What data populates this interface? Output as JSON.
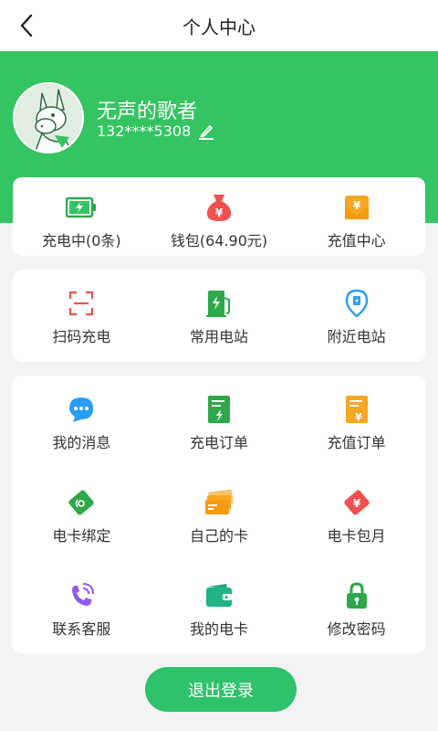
{
  "header": {
    "title": "个人中心",
    "back_icon": "chevron-left-icon"
  },
  "profile": {
    "name": "无声的歌者",
    "phone": "132****5308",
    "edit_icon": "pencil-icon",
    "avatar_icon": "donkey-avatar"
  },
  "colors": {
    "brand_green": "#35c462",
    "button_green": "#2ec26a",
    "red": "#f05050",
    "orange": "#f5a623",
    "blue": "#2a9df4",
    "purple": "#8e5cf0"
  },
  "summary": [
    {
      "label": "充电中(0条)",
      "icon": "battery-charging-icon"
    },
    {
      "label": "钱包(64.90元)",
      "icon": "money-bag-icon"
    },
    {
      "label": "充值中心",
      "icon": "recharge-envelope-icon"
    }
  ],
  "quick": [
    {
      "label": "扫码充电",
      "icon": "scan-icon"
    },
    {
      "label": "常用电站",
      "icon": "charging-station-icon"
    },
    {
      "label": "附近电站",
      "icon": "location-pin-icon"
    }
  ],
  "menu": [
    {
      "label": "我的消息",
      "icon": "message-icon"
    },
    {
      "label": "充电订单",
      "icon": "charge-order-icon"
    },
    {
      "label": "充值订单",
      "icon": "recharge-order-icon"
    },
    {
      "label": "电卡绑定",
      "icon": "card-bind-icon"
    },
    {
      "label": "自己的卡",
      "icon": "my-cards-icon"
    },
    {
      "label": "电卡包月",
      "icon": "monthly-card-icon"
    },
    {
      "label": "联系客服",
      "icon": "phone-service-icon"
    },
    {
      "label": "我的电卡",
      "icon": "wallet-icon"
    },
    {
      "label": "修改密码",
      "icon": "lock-icon"
    }
  ],
  "logout_label": "退出登录"
}
